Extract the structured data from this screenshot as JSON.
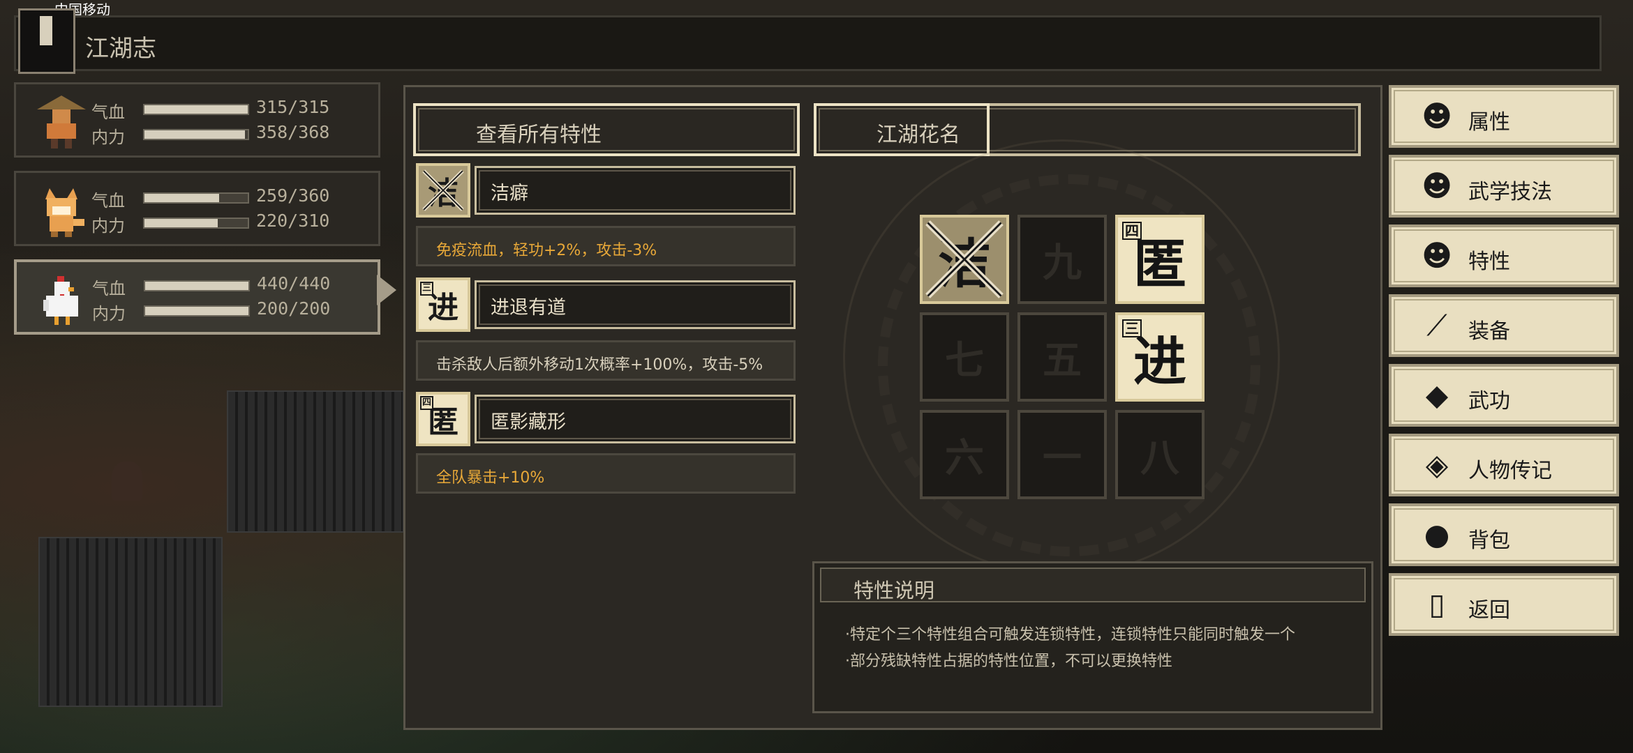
{
  "status": {
    "carrier": "中国移动"
  },
  "header": {
    "title": "江湖志"
  },
  "party": [
    {
      "hp_label": "气血",
      "hp": "315/315",
      "hp_fill": 1.0,
      "mp_label": "内力",
      "mp": "358/368",
      "mp_fill": 0.973
    },
    {
      "hp_label": "气血",
      "hp": "259/360",
      "hp_fill": 0.72,
      "mp_label": "内力",
      "mp": "220/310",
      "mp_fill": 0.71
    },
    {
      "hp_label": "气血",
      "hp": "440/440",
      "hp_fill": 1.0,
      "mp_label": "内力",
      "mp": "200/200",
      "mp_fill": 1.0
    }
  ],
  "tabs": {
    "all_traits": "查看所有特性",
    "nickname": "江湖花名"
  },
  "traits": [
    {
      "icon_char": "洁",
      "tag": "",
      "name": "洁癖",
      "desc": "免疫流血，轻功+2%，攻击-3%",
      "desc_color": "#e8a838"
    },
    {
      "icon_char": "进",
      "tag": "三",
      "name": "进退有道",
      "desc": "击杀敌人后额外移动1次概率+100%，攻击-5%",
      "desc_color": "#d8d0bc"
    },
    {
      "icon_char": "匿",
      "tag": "四",
      "name": "匿影藏形",
      "desc": "全队暴击+10%",
      "desc_color": "#e8a838"
    }
  ],
  "grid": [
    {
      "char": "洁",
      "tag": "",
      "filled": true,
      "cross": true
    },
    {
      "char": "九",
      "tag": "",
      "filled": false
    },
    {
      "char": "匿",
      "tag": "四",
      "filled": true
    },
    {
      "char": "七",
      "tag": "",
      "filled": false
    },
    {
      "char": "五",
      "tag": "",
      "filled": false
    },
    {
      "char": "进",
      "tag": "三",
      "filled": true
    },
    {
      "char": "六",
      "tag": "",
      "filled": false
    },
    {
      "char": "一",
      "tag": "",
      "filled": false
    },
    {
      "char": "八",
      "tag": "",
      "filled": false
    }
  ],
  "description": {
    "title": "特性说明",
    "lines": [
      "·特定个三个特性组合可触发连锁特性，连锁特性只能同时触发一个",
      "·部分残缺特性占据的特性位置，不可以更换特性"
    ]
  },
  "menu": [
    {
      "label": "属性",
      "icon": "person-icon"
    },
    {
      "label": "武学技法",
      "icon": "skill-icon"
    },
    {
      "label": "特性",
      "icon": "trait-icon"
    },
    {
      "label": "装备",
      "icon": "sword-icon"
    },
    {
      "label": "武功",
      "icon": "book-icon"
    },
    {
      "label": "人物传记",
      "icon": "scroll-icon"
    },
    {
      "label": "背包",
      "icon": "bag-icon"
    },
    {
      "label": "返回",
      "icon": "door-icon"
    }
  ]
}
